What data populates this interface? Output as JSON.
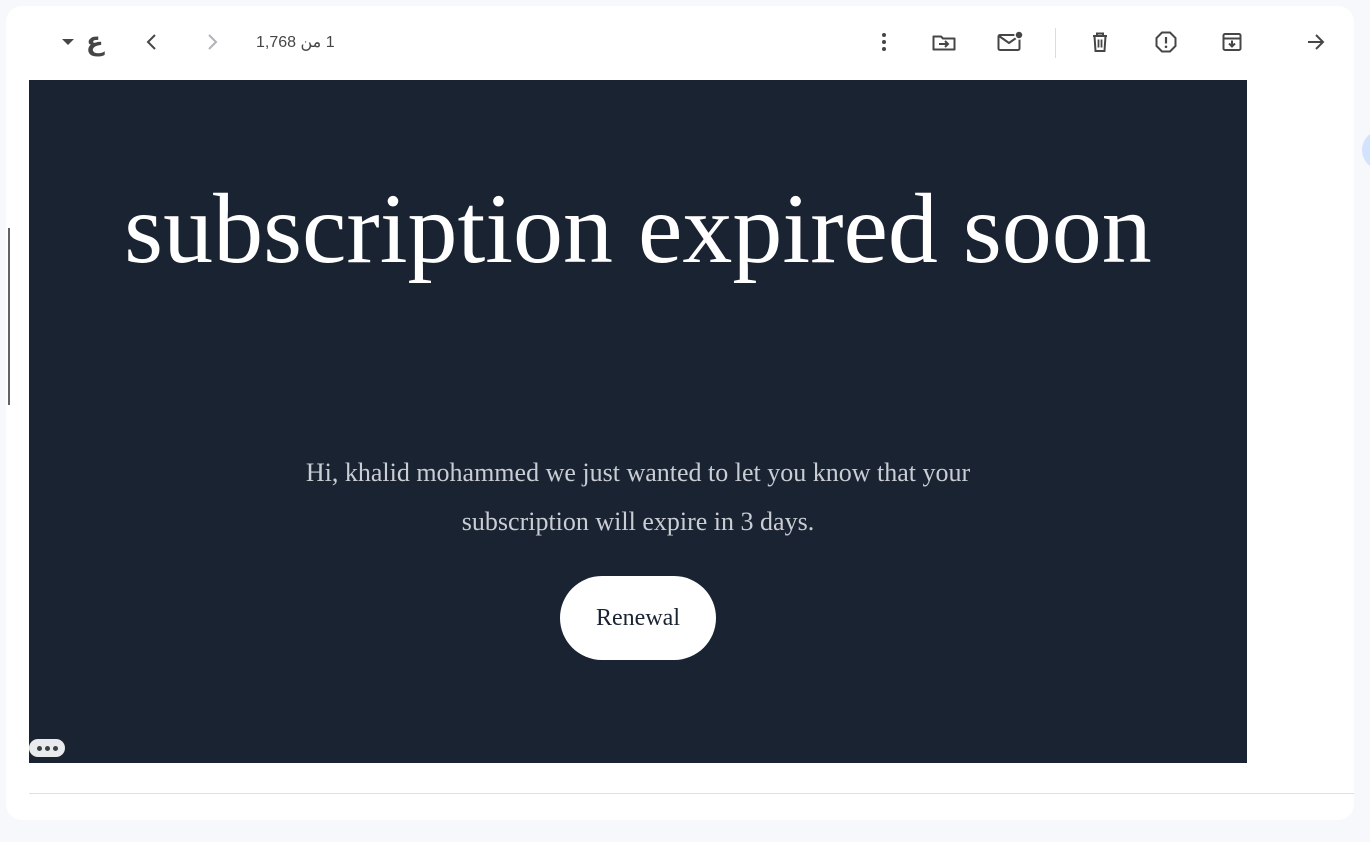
{
  "toolbar": {
    "back_label": "رجوع",
    "archive_label": "أرشفة",
    "report_spam_label": "الإبلاغ عن رسالة غير مرغوب فيها",
    "delete_label": "حذف",
    "mark_unread_label": "وضع علامة كغير مقروءة",
    "move_to_label": "نقل إلى",
    "more_label": "المزيد",
    "pagination": {
      "counter_text": "1 من 1,768",
      "newer_label": "أحدث",
      "older_label": "أقدم"
    },
    "language_toggle": {
      "glyph": "ع"
    }
  },
  "email": {
    "headline": "subscription expired soon",
    "message": "Hi, khalid mohammed we just wanted to let you know that your subscription will expire in 3 days.",
    "cta_label": "Renewal",
    "background_color": "#1a2332",
    "text_color": "#ffffff"
  },
  "trimmed_content_label": "•••",
  "icons": {
    "back": "arrow-right-icon",
    "archive": "archive-icon",
    "spam": "report-icon",
    "delete": "trash-icon",
    "unread": "mail-unread-icon",
    "move": "folder-move-icon",
    "more": "more-vert-icon",
    "prev": "chevron-left-icon",
    "next": "chevron-right-icon"
  }
}
